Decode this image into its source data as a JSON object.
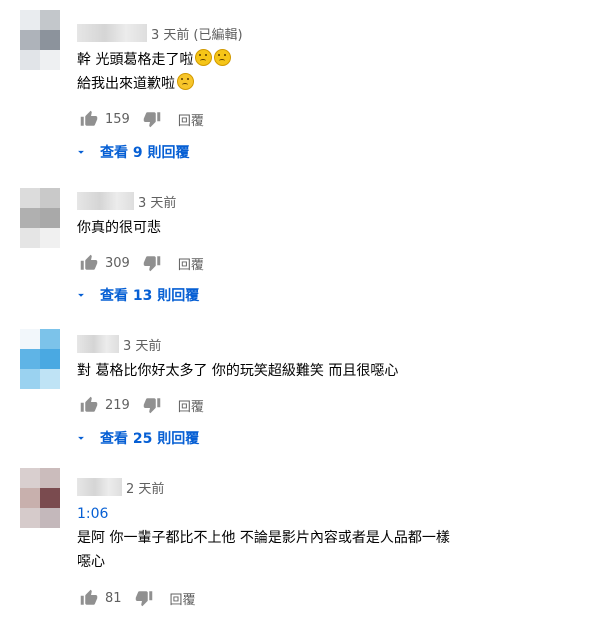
{
  "comments": [
    {
      "time": "3 天前",
      "edited": "(已編輯)",
      "lines": [
        "幹 光頭葛格走了啦",
        "給我出來道歉啦"
      ],
      "emoji_line1": [
        "worried-face-emoji",
        "worried-face-emoji"
      ],
      "emoji_line2": [
        "crying-face-emoji"
      ],
      "likes": "159",
      "reply_label": "回覆",
      "view_replies": "查看 9 則回覆",
      "avatar_colors": [
        "#e9ecef",
        "#c3c7cb",
        "#aeb3ba",
        "#8c939c",
        "#e1e4e8",
        "#eef0f2"
      ]
    },
    {
      "time": "3 天前",
      "lines": [
        "你真的很可悲"
      ],
      "likes": "309",
      "reply_label": "回覆",
      "view_replies": "查看 13 則回覆",
      "avatar_colors": [
        "#dcdcdc",
        "#c9c9c9",
        "#b0b0b0",
        "#a9a9a9",
        "#e5e5e5",
        "#f0f0f0"
      ]
    },
    {
      "time": "3 天前",
      "lines": [
        "對 葛格比你好太多了 你的玩笑超級難笑 而且很噁心"
      ],
      "likes": "219",
      "reply_label": "回覆",
      "view_replies": "查看 25 則回覆",
      "avatar_colors": [
        "#f2f7fb",
        "#7cc3ea",
        "#5fb4e6",
        "#4aa9e2",
        "#9ad2f0",
        "#bfe3f5"
      ]
    },
    {
      "time": "2 天前",
      "timestamp_link": "1:06",
      "lines": [
        "是阿 你一輩子都比不上他 不論是影片內容或者是人品都一樣",
        "噁心"
      ],
      "likes": "81",
      "reply_label": "回覆",
      "avatar_colors": [
        "#d9cfcf",
        "#cbbcbc",
        "#c8b0ad",
        "#7a4b4f",
        "#d6cbcb",
        "#c4b8bb"
      ]
    }
  ],
  "icons": {
    "like": "thumbs-up-icon",
    "dislike": "thumbs-down-icon",
    "expand": "caret-down-icon"
  },
  "colors": {
    "link": "#065fd4",
    "secondary_text": "#606060",
    "icon": "#909090"
  }
}
